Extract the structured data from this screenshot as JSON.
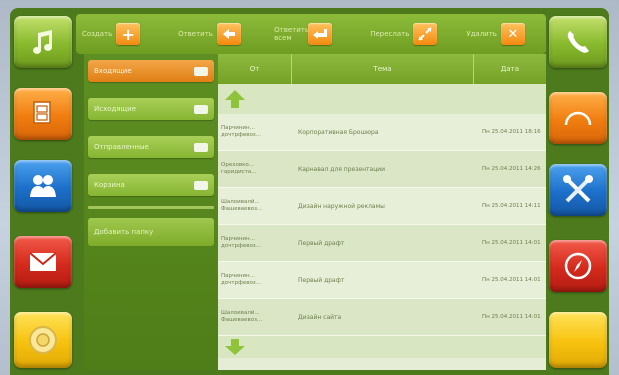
{
  "colors": {
    "bezel": "#4c7a1c",
    "accent_orange": "#f07d0f",
    "panel_green": "#86b532"
  },
  "sidebar_left": [
    {
      "name": "music",
      "icon": "music-note-icon",
      "color": "green"
    },
    {
      "name": "documents",
      "icon": "documents-icon",
      "color": "orange"
    },
    {
      "name": "contacts",
      "icon": "contacts-icon",
      "color": "blue"
    },
    {
      "name": "mail",
      "icon": "envelope-icon",
      "color": "red"
    },
    {
      "name": "settings-dial",
      "icon": "dial-icon",
      "color": "yellow"
    }
  ],
  "sidebar_right": [
    {
      "name": "phone",
      "icon": "phone-icon",
      "color": "green"
    },
    {
      "name": "speedometer",
      "icon": "speedometer-icon",
      "color": "orange"
    },
    {
      "name": "tools",
      "icon": "tools-icon",
      "color": "blue"
    },
    {
      "name": "compass",
      "icon": "compass-icon",
      "color": "red"
    },
    {
      "name": "blank",
      "icon": "",
      "color": "yellow"
    }
  ],
  "toolbar": {
    "create_label": "Создать",
    "reply_label": "Ответить",
    "reply_all_label": "Ответить всем",
    "forward_label": "Переслать",
    "delete_label": "Удалить"
  },
  "folders": {
    "items": [
      {
        "label": "Входящие",
        "count": ""
      },
      {
        "label": "Исходящие",
        "count": ""
      },
      {
        "label": "Отправленные",
        "count": ""
      },
      {
        "label": "Корзина",
        "count": ""
      }
    ],
    "add_label": "Добавить папку"
  },
  "table": {
    "headers": {
      "from": "От",
      "subject": "Тема",
      "date": "Дата"
    },
    "rows": [
      {
        "from": "Парчинин... дочтрфевоз...",
        "subject": "Корпоративная Брошюра",
        "date": "Пн 25.04.2011 18:16"
      },
      {
        "from": "Ореховко... гаридиста...",
        "subject": "Карнавал для презентации",
        "date": "Пн 25.04.2011 14:26"
      },
      {
        "from": "Шалоивалй... Фашеваевоз...",
        "subject": "Дизайн наружной рекламы",
        "date": "Пн 25.04.2011 14:11"
      },
      {
        "from": "Парчинин... дочтрфевоз...",
        "subject": "Первый драфт",
        "date": "Пн 25.04.2011 14:01"
      },
      {
        "from": "Парчинин... дочтрфевоз...",
        "subject": "Первый драфт",
        "date": "Пн 25.04.2011 14:01"
      },
      {
        "from": "Шалоивалй... Фашеваевоз...",
        "subject": "Дизайн сайта",
        "date": "Пн 25.04.2011 14:01"
      }
    ]
  }
}
